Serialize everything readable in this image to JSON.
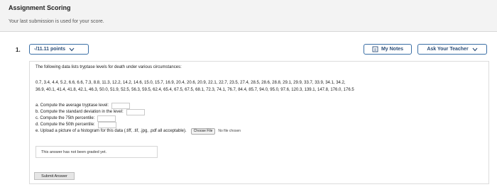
{
  "header": {
    "title": "Assignment Scoring",
    "subtitle": "Your last submission is used for your score."
  },
  "question": {
    "number": "1.",
    "points_label": "-/11.11 points",
    "notes_label": "My Notes",
    "teacher_label": "Ask Your Teacher",
    "prompt": "The following data lists tryptase levels for death under various circumstances:",
    "data_line1": "0.7, 3.4, 4.4, 5.2, 6.6, 6.6, 7.3, 8.8, 11.3, 12.2, 14.2, 14.6, 15.0, 15.7, 16.9, 20.4, 20.6, 20.9, 22.1, 22.7, 23.5, 27.4, 28.5, 28.6, 28.8, 29.1, 29.9, 33.7, 33.9, 34.1, 34.2,",
    "data_line2": "36.9, 40.1, 41.4, 41.8, 42.1, 46.3, 50.0, 51.9, 52.5, 56.3, 59.5, 62.4, 65.4, 67.5, 67.5, 68.1, 72.3, 74.1, 76.7, 84.4, 85.7, 94.0, 95.0, 97.6, 120.3, 139.1, 147.8, 176.0, 176.5",
    "parts": [
      "a. Compute the average tryptase level:",
      "b. Compute the standard deviation in the level:",
      "c. Compute the 75th percentile:",
      "d. Compute the 50th percentile:",
      "e. Upload a picture of a histogram for this data (.tiff, .tif, .jpg, .pdf all acceptable)."
    ],
    "choose_file_label": "Choose File",
    "no_file_label": "No file chosen",
    "graded_note": "This answer has not been graded yet.",
    "submit_label": "Submit Answer"
  },
  "colors": {
    "accent": "#3a6ea5",
    "header_bg": "#f3f3f3"
  },
  "icons": [
    "chevron-down-icon",
    "notes-icon"
  ]
}
